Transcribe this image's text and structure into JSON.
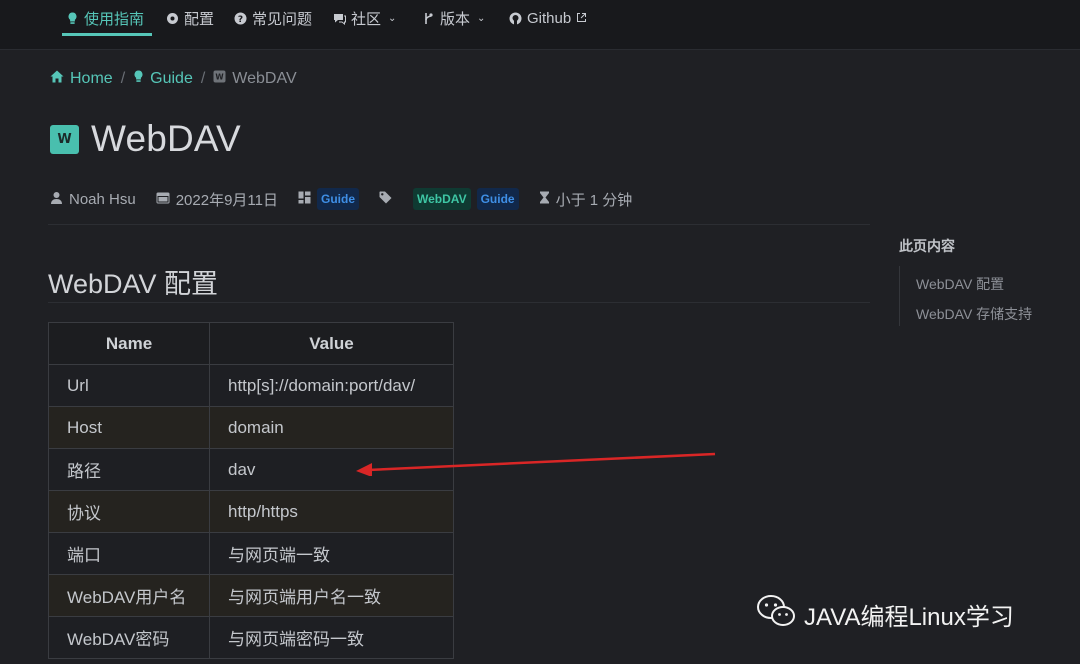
{
  "nav": {
    "items": [
      {
        "label": "使用指南",
        "icon": "bulb-icon",
        "active": true
      },
      {
        "label": "配置",
        "icon": "gear-icon"
      },
      {
        "label": "常见问题",
        "icon": "question-icon"
      },
      {
        "label": "社区",
        "icon": "chat-icon",
        "dropdown": true
      },
      {
        "label": "版本",
        "icon": "branch-icon",
        "dropdown": true
      },
      {
        "label": "Github",
        "icon": "github-icon",
        "external": true
      }
    ],
    "accent": "#56c6b8"
  },
  "breadcrumb": {
    "home": "Home",
    "guide": "Guide",
    "current": "WebDAV",
    "separator": "/"
  },
  "page": {
    "logo_letter": "W",
    "title": "WebDAV"
  },
  "meta": {
    "author": "Noah Hsu",
    "date": "2022年9月11日",
    "category_tag": "Guide",
    "tags": [
      "WebDAV",
      "Guide"
    ],
    "reading_time": "小于 1 分钟"
  },
  "section": {
    "title": "WebDAV 配置"
  },
  "table": {
    "headers": [
      "Name",
      "Value"
    ],
    "rows": [
      {
        "name": "Url",
        "value": "http[s]://domain:port/dav/"
      },
      {
        "name": "Host",
        "value": "domain"
      },
      {
        "name": "路径",
        "value": "dav"
      },
      {
        "name": "协议",
        "value": "http/https"
      },
      {
        "name": "端口",
        "value": "与网页端一致"
      },
      {
        "name": "WebDAV用户名",
        "value": "与网页端用户名一致"
      },
      {
        "name": "WebDAV密码",
        "value": "与网页端密码一致"
      }
    ]
  },
  "toc": {
    "title": "此页内容",
    "items": [
      "WebDAV 配置",
      "WebDAV 存储支持"
    ]
  },
  "annotation": {
    "arrow_color": "#d92626"
  },
  "watermark": {
    "text": "JAVA编程Linux学习",
    "icon": "wechat-icon"
  }
}
